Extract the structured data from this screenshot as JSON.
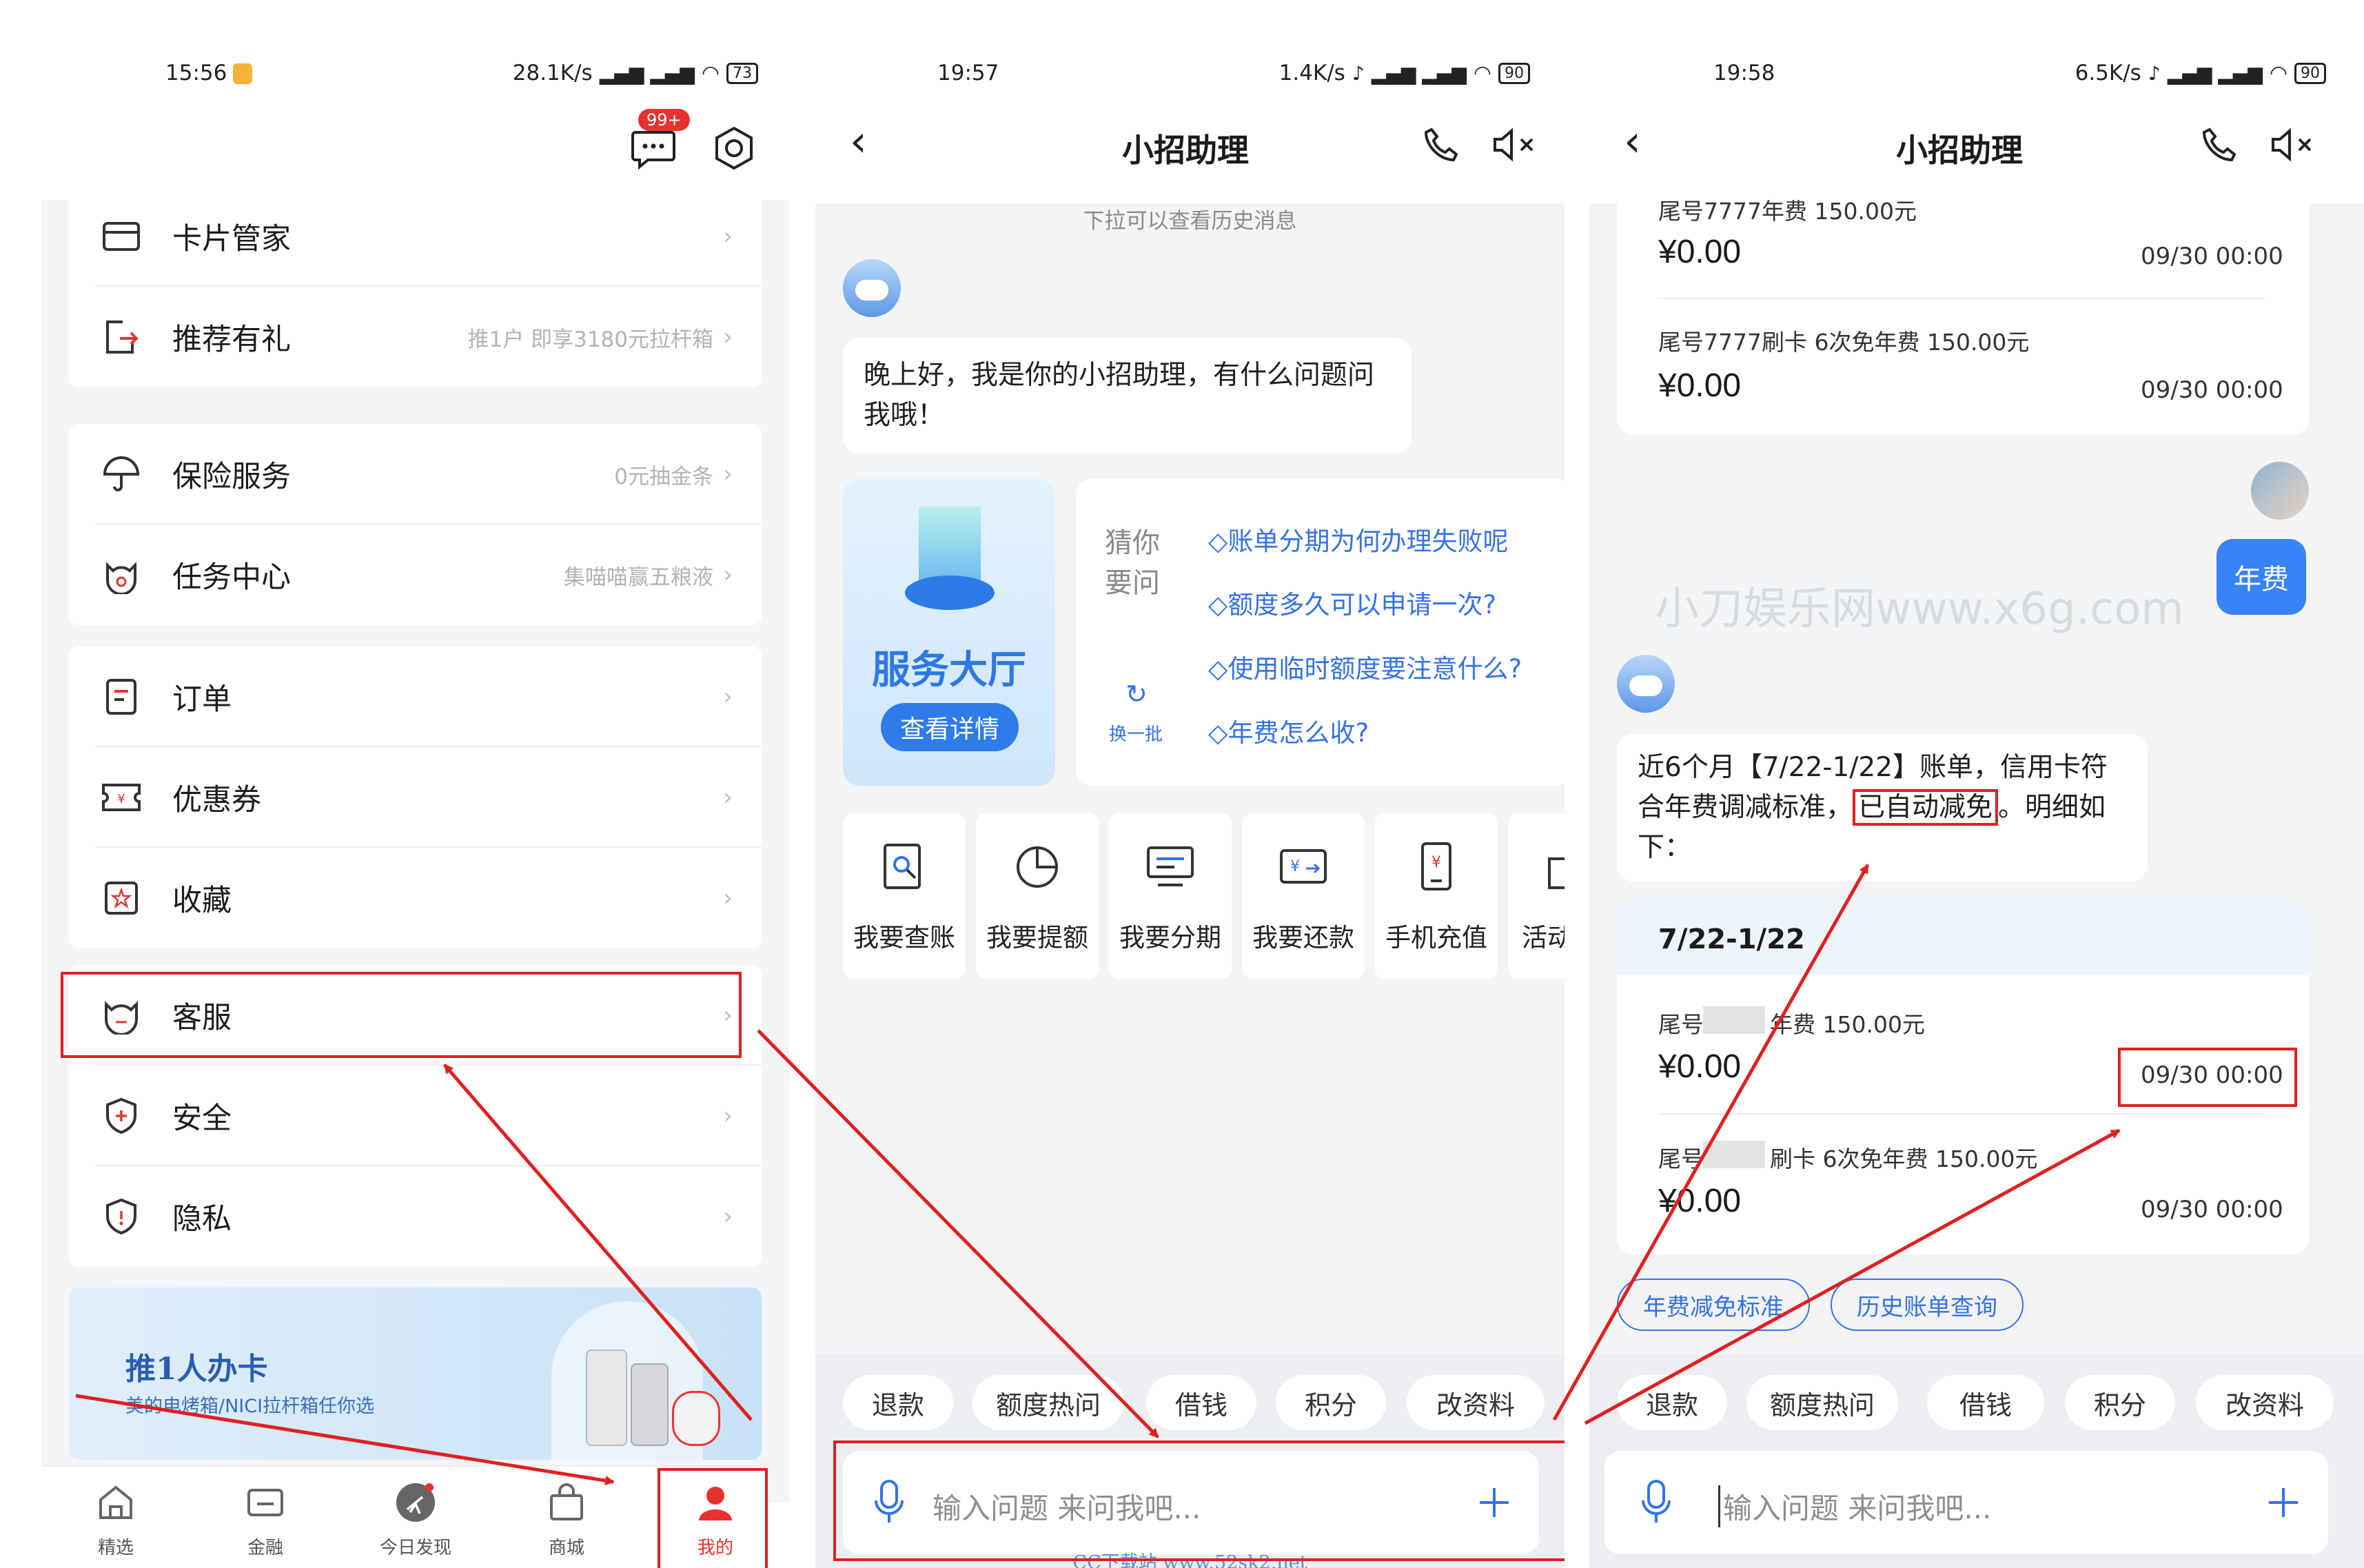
{
  "panel1": {
    "status": {
      "time": "15:56",
      "right": "28.1K/s",
      "battery": "73"
    },
    "badge": "99+",
    "group1": [
      {
        "label": "卡片管家",
        "hint": ""
      },
      {
        "label": "推荐有礼",
        "hint": "推1户 即享3180元拉杆箱"
      }
    ],
    "group2": [
      {
        "label": "保险服务",
        "hint": "0元抽金条"
      },
      {
        "label": "任务中心",
        "hint": "集喵喵赢五粮液"
      }
    ],
    "group3": [
      {
        "label": "订单",
        "hint": ""
      },
      {
        "label": "优惠券",
        "hint": ""
      },
      {
        "label": "收藏",
        "hint": ""
      }
    ],
    "group4": [
      {
        "label": "客服",
        "hint": ""
      },
      {
        "label": "安全",
        "hint": ""
      },
      {
        "label": "隐私",
        "hint": ""
      }
    ],
    "banner": {
      "title": "推1人办卡",
      "subtitle": "美的电烤箱/NICI拉杆箱任你选"
    },
    "tabs": [
      "精选",
      "金融",
      "今日发现",
      "商城",
      "我的"
    ]
  },
  "panel2": {
    "status": {
      "time": "19:57",
      "right": "1.4K/s",
      "battery": "90"
    },
    "title": "小招助理",
    "pull_hint": "下拉可以查看历史消息",
    "greeting": "晚上好，我是你的小招助理，有什么问题问我哦！",
    "service_hall": {
      "title": "服务大厅",
      "button": "查看详情"
    },
    "guess": {
      "label1": "猜你",
      "label2": "要问",
      "refresh": "换一批",
      "questions": [
        "◇账单分期为何办理失败呢",
        "◇额度多久可以申请一次?",
        "◇使用临时额度要注意什么?",
        "◇年费怎么收?"
      ]
    },
    "functions": [
      "我要查账",
      "我要提额",
      "我要分期",
      "我要还款",
      "手机充值",
      "活动"
    ],
    "chips": [
      "退款",
      "额度热问",
      "借钱",
      "积分",
      "改资料"
    ],
    "input_placeholder": "输入问题 来问我吧...",
    "footer_watermark": "CC下载站 www.52sk2.net"
  },
  "panel3": {
    "status": {
      "time": "19:58",
      "right": "6.5K/s",
      "battery": "90"
    },
    "title": "小招助理",
    "top_partial": "尾号7777年费  150.00元",
    "top_amount": "¥0.00",
    "top_date": "09/30 00:00",
    "top_row2_desc": "尾号7777刷卡   6次免年费   150.00元",
    "top_row2_amount": "¥0.00",
    "top_row2_date": "09/30 00:00",
    "user_msg": "年费",
    "watermark": "小刀娱乐网www.x6g.com",
    "reply_part1": "近6个月【7/22-1/22】账单，信用卡符合年费调减标准，",
    "reply_highlight": "已自动减免",
    "reply_part2": "。明细如下：",
    "period": "7/22-1/22",
    "bill1_prefix": "尾号",
    "bill1_suffix": "年费   150.00元",
    "bill1_amount": "¥0.00",
    "bill1_date": "09/30 00:00",
    "bill2_prefix": "尾号",
    "bill2_suffix": "刷卡   6次免年费   150.00元",
    "bill2_amount": "¥0.00",
    "bill2_date": "09/30 00:00",
    "actions": [
      "年费减免标准",
      "历史账单查询"
    ],
    "chips": [
      "退款",
      "额度热问",
      "借钱",
      "积分",
      "改资料"
    ],
    "input_placeholder": "输入问题 来问我吧..."
  }
}
